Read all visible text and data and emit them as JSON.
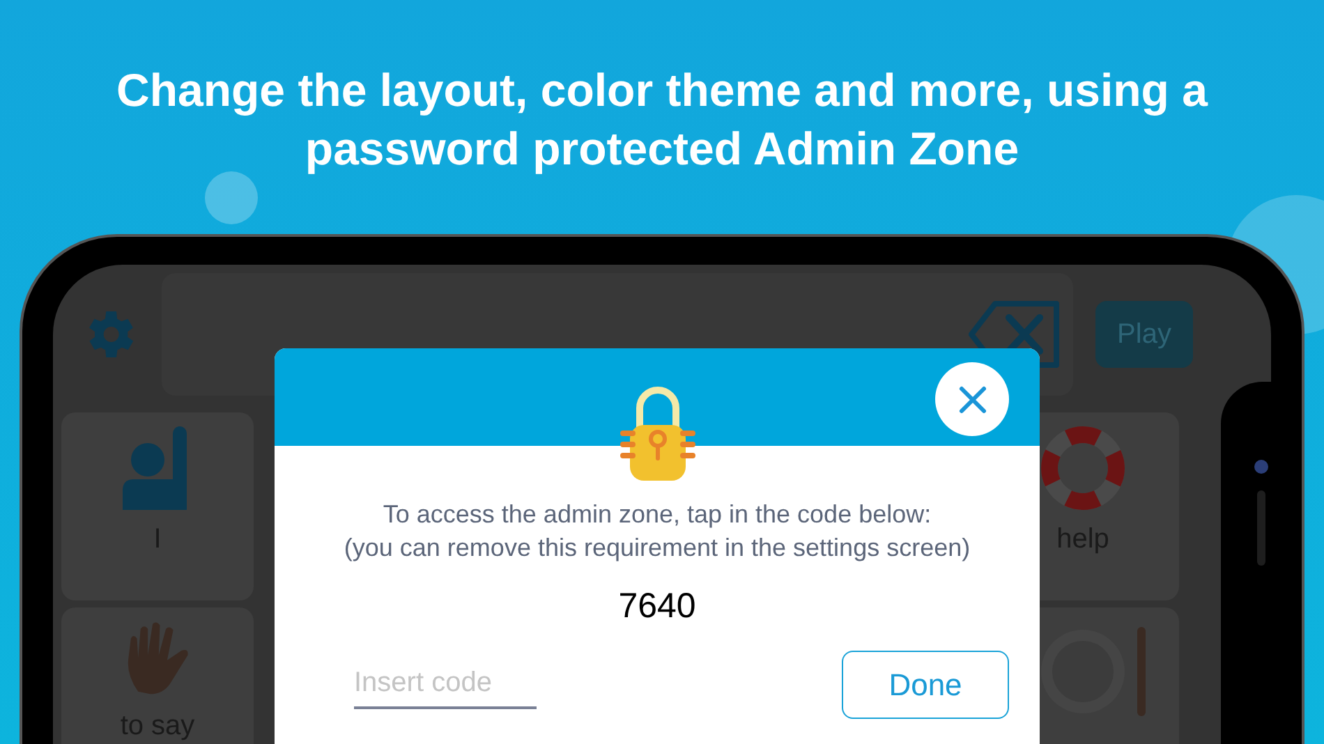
{
  "headline": "Change the layout, color theme and more, using a password protected Admin Zone",
  "top_bar": {
    "play_button": "Play"
  },
  "tiles": [
    {
      "kind": "person",
      "label": "I"
    },
    {
      "kind": "hand",
      "label": "to say"
    },
    {
      "kind": "lifebuoy",
      "label": "help"
    },
    {
      "kind": "plate"
    }
  ],
  "dialog": {
    "message_lines": [
      "To access the admin zone, tap in the code below:",
      "(you can remove this requirement in the settings screen)"
    ],
    "code": "7640",
    "input": {
      "placeholder": "Insert code"
    },
    "done_button": "Done"
  }
}
